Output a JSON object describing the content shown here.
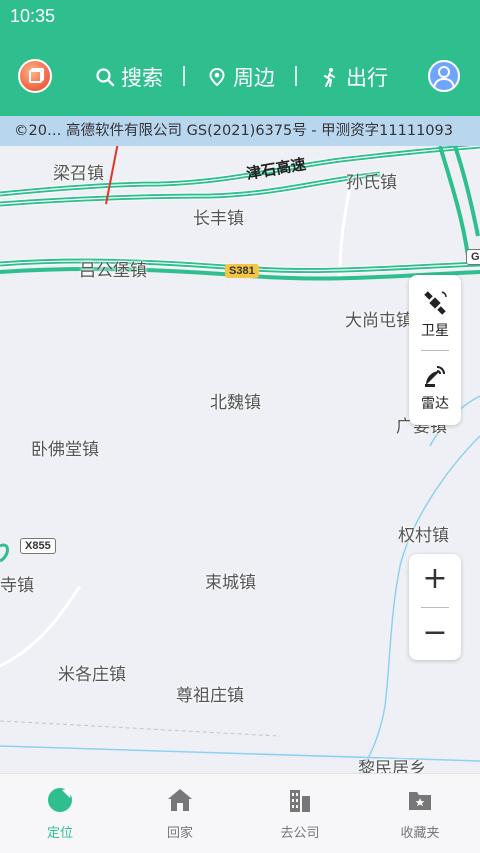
{
  "status": {
    "time": "10:35"
  },
  "nav": {
    "search_label": "搜索",
    "nearby_label": "周边",
    "travel_label": "出行"
  },
  "copyright": "©20… 高德软件有限公司 GS(2021)6375号 - 甲测资字11111093",
  "map": {
    "places": {
      "liangzhao": "梁召镇",
      "sunshi": "孙氏镇",
      "changfeng": "长丰镇",
      "lvgongbao": "吕公堡镇",
      "dashangtun": "大尚屯镇",
      "beiwei": "北魏镇",
      "wofotang": "卧佛堂镇",
      "guangyao": "广要镇",
      "quancun": "权村镇",
      "simen": "寺镇",
      "shucheng": "束城镇",
      "mige": "米各庄镇",
      "zunzu": "尊祖庄镇",
      "limin": "黎民居乡"
    },
    "highway_name": "津石高速",
    "road_s381": "S381",
    "road_x855": "X855",
    "road_g": "G"
  },
  "controls": {
    "satellite_label": "卫星",
    "radar_label": "雷达",
    "zoom_in": "+",
    "zoom_out": "−"
  },
  "tabs": {
    "locate": "定位",
    "home": "回家",
    "work": "去公司",
    "favorites": "收藏夹"
  },
  "colors": {
    "brand": "#2fbf8f",
    "highway": "#2fbf8f",
    "annotation_arrow": "#e0352b"
  }
}
